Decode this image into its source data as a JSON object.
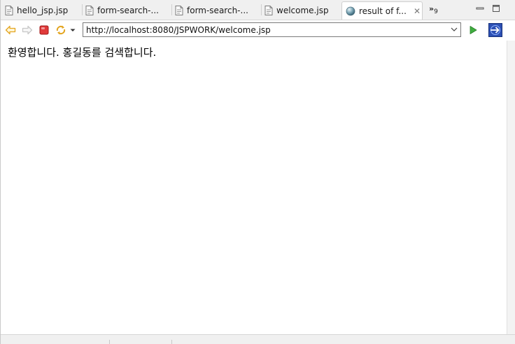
{
  "tabs": [
    {
      "label": "hello_jsp.jsp",
      "icon": "jsp-file-icon",
      "active": false
    },
    {
      "label": "form-search-...",
      "icon": "jsp-file-icon",
      "active": false
    },
    {
      "label": "form-search-...",
      "icon": "jsp-file-icon",
      "active": false
    },
    {
      "label": "welcome.jsp",
      "icon": "jsp-file-icon",
      "active": false
    },
    {
      "label": "result of f...",
      "icon": "globe-icon",
      "active": true,
      "close": "✕"
    }
  ],
  "overflow": {
    "glyph": "»",
    "count": "9"
  },
  "toolbar": {
    "url": "http://localhost:8080/JSPWORK/welcome.jsp"
  },
  "content": {
    "message": "환영합니다. 홍길동를 검색합니다."
  },
  "colors": {
    "nav_arrow": "#e8b23a",
    "stop": "#d62c2c",
    "go": "#3aa63a",
    "external": "#2a4fb0"
  }
}
